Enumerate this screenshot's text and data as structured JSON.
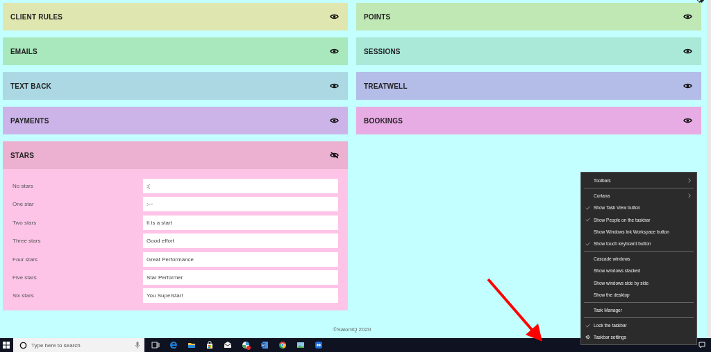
{
  "panels_left": [
    {
      "title": "CLIENT RULES",
      "color": "#e0e6b0",
      "expanded": false
    },
    {
      "title": "EMAILS",
      "color": "#a8e8bc",
      "expanded": false
    },
    {
      "title": "TEXT BACK",
      "color": "#acd8e4",
      "expanded": false
    },
    {
      "title": "PAYMENTS",
      "color": "#ccb4e8",
      "expanded": false
    },
    {
      "title": "STARS",
      "color": "#ecb0d0",
      "expanded": true,
      "rows": [
        {
          "label": "No stars",
          "value": ":("
        },
        {
          "label": "One star",
          "value": ":-~"
        },
        {
          "label": "Two stars",
          "value": "It is a start"
        },
        {
          "label": "Three stars",
          "value": "Good effort"
        },
        {
          "label": "Four stars",
          "value": "Great Performance"
        },
        {
          "label": "Five stars",
          "value": "Star Performer"
        },
        {
          "label": "Six stars",
          "value": "You Superstar!"
        }
      ]
    }
  ],
  "panels_right": [
    {
      "title": "POINTS",
      "color": "#c0e8b4",
      "expanded": false
    },
    {
      "title": "SESSIONS",
      "color": "#aae8d8",
      "expanded": false
    },
    {
      "title": "TREATWELL",
      "color": "#b4bce8",
      "expanded": false
    },
    {
      "title": "BOOKINGS",
      "color": "#e8ace4",
      "expanded": false
    }
  ],
  "footer": "©SalonIQ 2020",
  "taskbar": {
    "search": {
      "placeholder": "Type here to search"
    }
  },
  "context_menu": [
    {
      "kind": "submenu",
      "label": "Toolbars",
      "checked": false
    },
    {
      "kind": "separator"
    },
    {
      "kind": "submenu",
      "label": "Cortana",
      "checked": false
    },
    {
      "kind": "item",
      "label": "Show Task View button",
      "checked": true
    },
    {
      "kind": "item",
      "label": "Show People on the taskbar",
      "checked": true
    },
    {
      "kind": "item",
      "label": "Show Windows Ink Workspace button",
      "checked": false
    },
    {
      "kind": "item",
      "label": "Show touch keyboard button",
      "checked": true
    },
    {
      "kind": "separator"
    },
    {
      "kind": "item",
      "label": "Cascade windows",
      "checked": false
    },
    {
      "kind": "item",
      "label": "Show windows stacked",
      "checked": false
    },
    {
      "kind": "item",
      "label": "Show windows side by side",
      "checked": false
    },
    {
      "kind": "item",
      "label": "Show the desktop",
      "checked": false
    },
    {
      "kind": "separator"
    },
    {
      "kind": "item",
      "label": "Task Manager",
      "checked": false
    },
    {
      "kind": "separator"
    },
    {
      "kind": "item",
      "label": "Lock the taskbar",
      "checked": true
    },
    {
      "kind": "settings",
      "label": "Taskbar settings",
      "checked": false
    }
  ]
}
